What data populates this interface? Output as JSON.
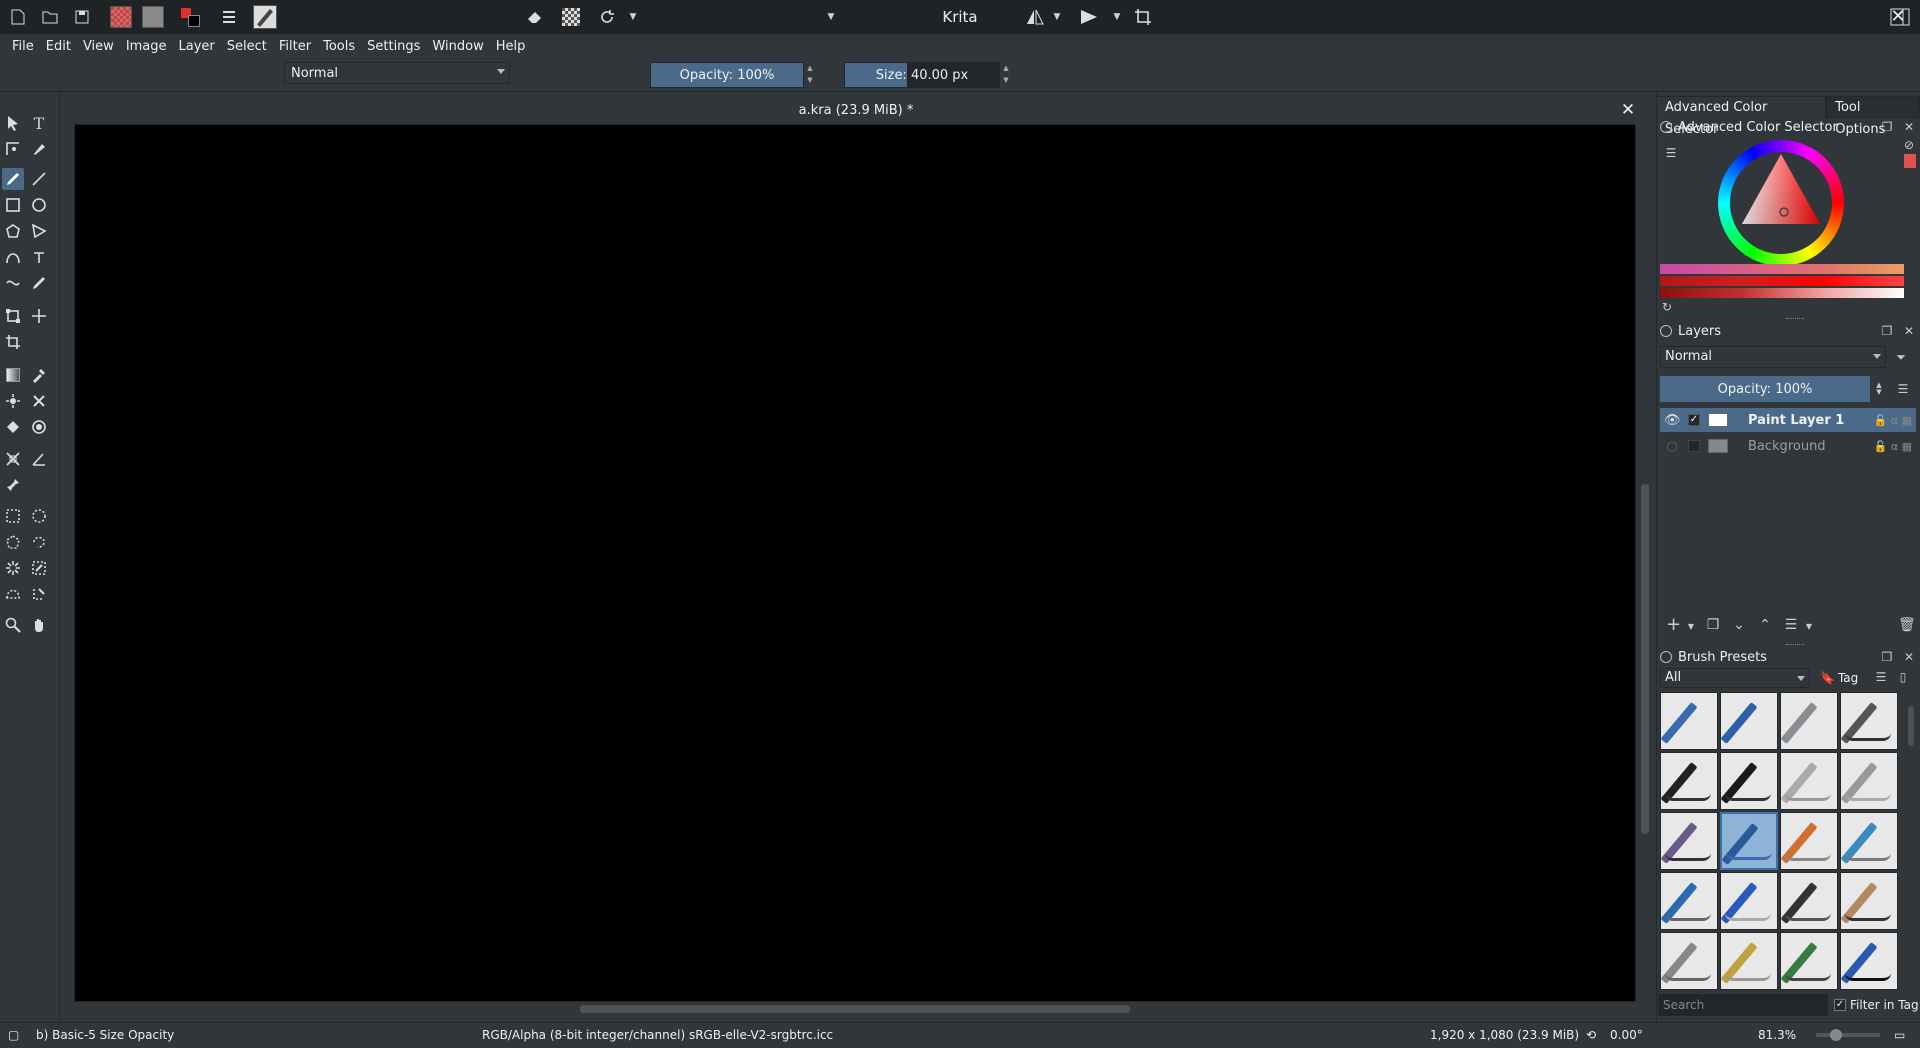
{
  "window": {
    "title": "Krita"
  },
  "menu": [
    "File",
    "Edit",
    "View",
    "Image",
    "Layer",
    "Select",
    "Filter",
    "Tools",
    "Settings",
    "Window",
    "Help"
  ],
  "toolbar": {
    "blend_mode": "Normal",
    "opacity_label": "Opacity: 100%",
    "opacity_value": 1.0,
    "size_label": "Size: 40.00 px",
    "size_fraction": 0.4
  },
  "document": {
    "title": "a.kra (23.9 MiB) *"
  },
  "dock": {
    "tabs": [
      "Advanced Color Selector",
      "Tool Options"
    ],
    "color_selector_title": "Advanced Color Selector",
    "layers_title": "Layers",
    "layers_blend_mode": "Normal",
    "layers_opacity": "Opacity: 100%",
    "layers": [
      {
        "name": "Paint Layer 1",
        "selected": true,
        "visible": true
      },
      {
        "name": "Background",
        "selected": false,
        "visible": false
      }
    ],
    "brush_presets_title": "Brush Presets",
    "brush_filter": "All",
    "tag_label": "Tag",
    "search_placeholder": "Search",
    "filter_in_tag": "Filter in Tag"
  },
  "status": {
    "brush": "b) Basic-5 Size Opacity",
    "color_space": "RGB/Alpha (8-bit integer/channel)  sRGB-elle-V2-srgbtrc.icc",
    "image_size": "1,920 x 1,080 (23.9 MiB)",
    "rotation": "0.00°",
    "zoom": "81.3%"
  },
  "colors": {
    "accent": "#4b6a8a",
    "foreground": "#e03030",
    "background": "#000000"
  }
}
